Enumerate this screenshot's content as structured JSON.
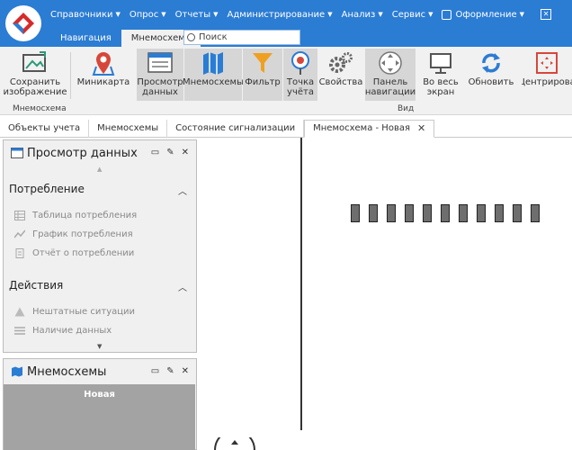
{
  "menu": [
    {
      "label": "Справочники"
    },
    {
      "label": "Опрос"
    },
    {
      "label": "Отчеты"
    },
    {
      "label": "Администрирование"
    },
    {
      "label": "Анализ"
    },
    {
      "label": "Сервис"
    },
    {
      "label": "Оформление"
    }
  ],
  "ribbon_tabs": [
    "Навигация",
    "Мнемосхема"
  ],
  "search": {
    "placeholder": "Поиск"
  },
  "ribbon": {
    "save": "Сохранить изображение",
    "group_mnemo": "Мнемосхема",
    "minimap": "Миникарта",
    "view_data": "Просмотр данных",
    "mnemos": "Мнемосхемы",
    "filter": "Фильтр",
    "point": "Точка учёта",
    "props": "Свойства",
    "navpanel": "Панель навигации",
    "fullscreen": "Во весь экран",
    "refresh": "Обновить",
    "center": "Центрирова",
    "group_view": "Вид"
  },
  "doc_tabs": [
    "Объекты учета",
    "Мнемосхемы",
    "Состояние сигнализации",
    "Мнемосхема - Новая"
  ],
  "panel_view": {
    "title": "Просмотр данных",
    "section1": "Потребление",
    "items1": [
      "Таблица потребления",
      "График потребления",
      "Отчёт о потреблении"
    ],
    "section2": "Действия",
    "items2": [
      "Нештатные ситуации",
      "Наличие данных"
    ]
  },
  "panel_mnemo": {
    "title": "Мнемосхемы",
    "item": "Новая"
  },
  "colors": {
    "accent": "#2b7cd3",
    "selected": "#d6d6d6"
  }
}
